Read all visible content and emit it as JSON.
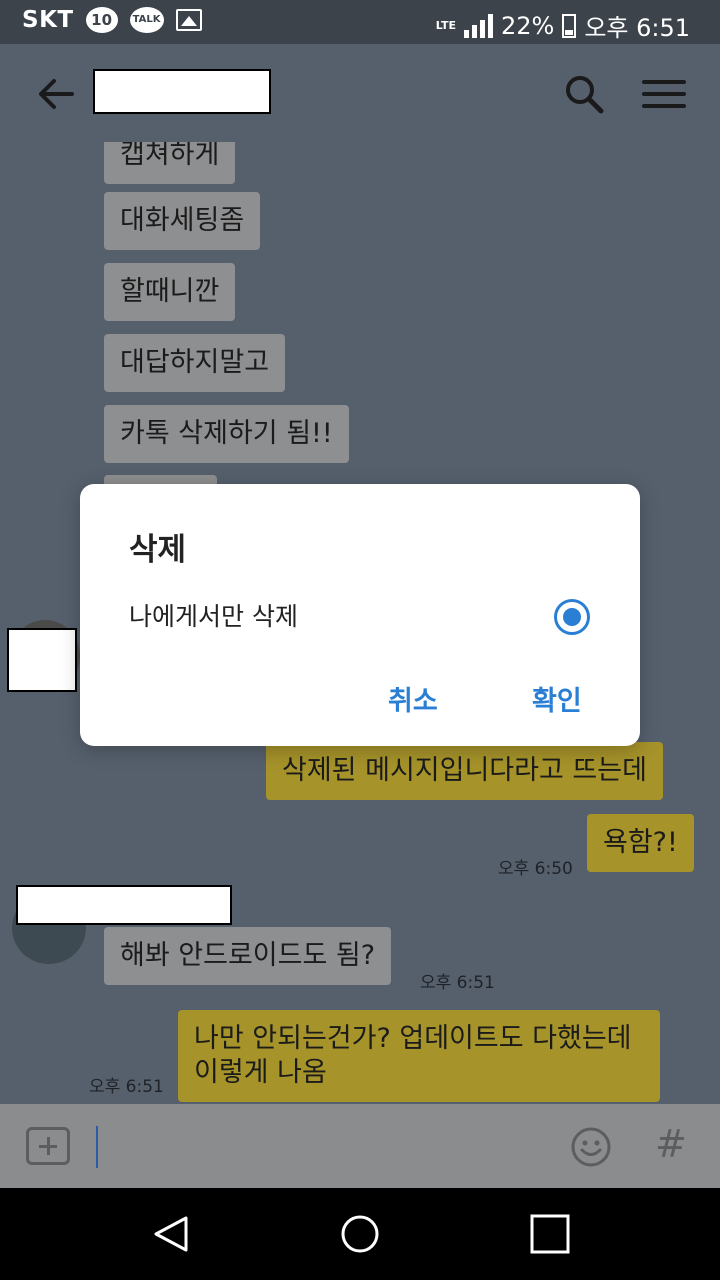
{
  "status_bar": {
    "carrier": "SKT",
    "notif_badge": "10",
    "talk_badge": "TALK",
    "network": "LTE",
    "battery": "22%",
    "time": "오후 6:51"
  },
  "icons": {
    "back": "arrow-left-icon",
    "search": "search-icon",
    "menu": "menu-icon",
    "attach": "plus-box-icon",
    "emoji": "emoji-icon",
    "hashtag": "hash-icon",
    "nav_back": "triangle-back-icon",
    "nav_home": "circle-home-icon",
    "nav_recent": "square-recent-icon"
  },
  "messages": [
    {
      "side": "in",
      "text": "캡쳐하게"
    },
    {
      "side": "in",
      "text": "대화세팅좀"
    },
    {
      "side": "in",
      "text": "할때니깐"
    },
    {
      "side": "in",
      "text": "대답하지말고"
    },
    {
      "side": "in",
      "text": "카톡 삭제하기 됨!!"
    },
    {
      "side": "out",
      "text": "삭제된 메시지입니다라고 뜨는데"
    },
    {
      "side": "out",
      "text": "욕함?!",
      "time": "오후 6:50"
    },
    {
      "side": "in",
      "text": "해봐 안드로이드도 됨?",
      "time": "오후 6:51"
    },
    {
      "side": "out",
      "text": "나만 안되는건가? 업데이트도 다했는데",
      "text2": "이렇게 나옴",
      "time": "오후 6:51"
    }
  ],
  "dialog": {
    "title": "삭제",
    "option": "나에게서만 삭제",
    "option_selected": true,
    "cancel": "취소",
    "confirm": "확인"
  },
  "colors": {
    "chat_bg": "#56606d",
    "incoming_bubble": "#8e8f90",
    "outgoing_bubble": "#a6932a",
    "accent": "#2a7fd4"
  }
}
